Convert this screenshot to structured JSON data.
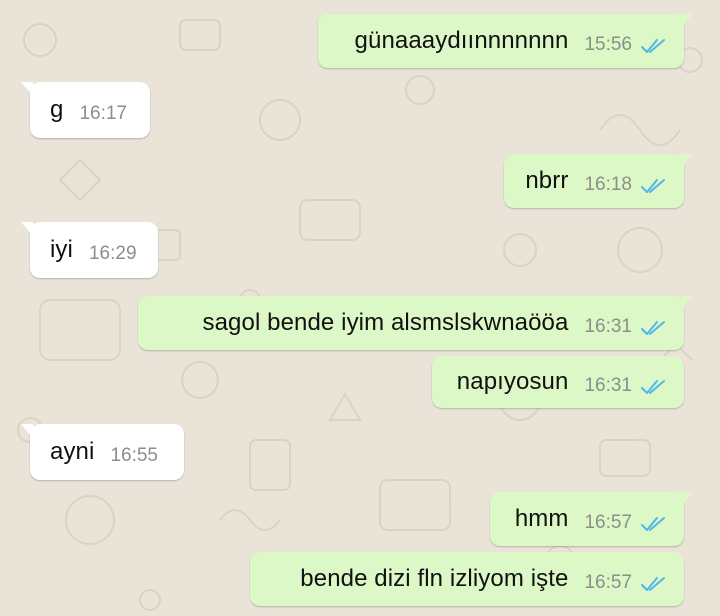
{
  "messages": [
    {
      "dir": "out",
      "text": "günaaaydıınnnnnnn",
      "time": "15:56",
      "status": "read",
      "icon": "double-check-icon"
    },
    {
      "dir": "in",
      "text": "g",
      "time": "16:17"
    },
    {
      "dir": "out",
      "text": "nbrr",
      "time": "16:18",
      "status": "read",
      "icon": "double-check-icon"
    },
    {
      "dir": "in",
      "text": "iyi",
      "time": "16:29"
    },
    {
      "dir": "out",
      "text": "sagol bende iyim alsmslskwnaööa",
      "time": "16:31",
      "status": "read",
      "icon": "double-check-icon"
    },
    {
      "dir": "out",
      "text": "napıyosun",
      "time": "16:31",
      "status": "read",
      "icon": "double-check-icon"
    },
    {
      "dir": "in",
      "text": "ayni",
      "time": "16:55"
    },
    {
      "dir": "out",
      "text": "hmm",
      "time": "16:57",
      "status": "read",
      "icon": "double-check-icon"
    },
    {
      "dir": "out",
      "text": "bende dizi fln izliyom işte",
      "time": "16:57",
      "status": "read",
      "icon": "double-check-icon"
    }
  ],
  "colors": {
    "wallpaper": "#e9e3d8",
    "outgoing_bubble": "#dcf8c6",
    "incoming_bubble": "#ffffff",
    "read_check": "#4fb6ec",
    "timestamp": "#8a8f8a"
  }
}
